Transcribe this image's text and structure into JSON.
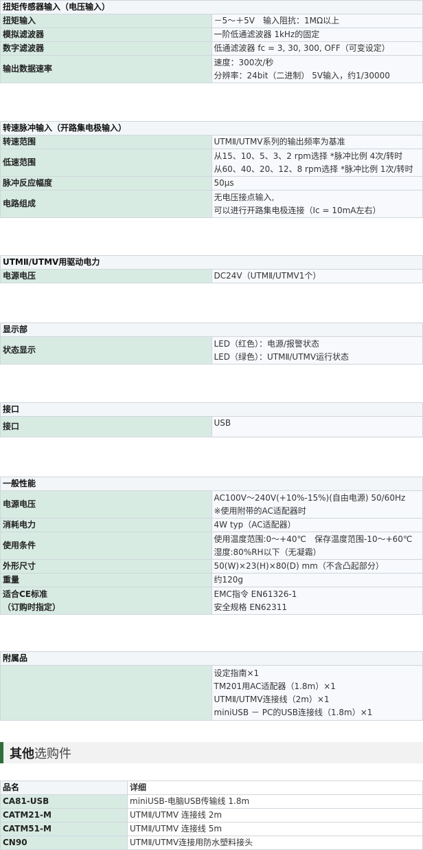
{
  "sections": [
    {
      "title": "扭矩传感器输入（电压输入）",
      "rows": [
        {
          "label": "扭矩输入",
          "lines": [
            "－5～＋5V　输入阻抗：1MΩ以上"
          ]
        },
        {
          "label": "模拟滤波器",
          "lines": [
            "一阶低通滤波器 1kHz的固定"
          ]
        },
        {
          "label": "数字滤波器",
          "lines": [
            "低通滤波器 fc = 3, 30, 300, OFF（可变设定）"
          ]
        },
        {
          "label": "输出数据速率",
          "lines": [
            "速度：300次/秒",
            "分辨率：24bit（二进制） 5V输入，约1/30000"
          ]
        }
      ]
    },
    {
      "title": "转速脉冲输入（开路集电极输入）",
      "rows": [
        {
          "label": "转速范围",
          "lines": [
            "UTMⅡ/UTMV系列的输出频率为基准"
          ]
        },
        {
          "label": "低速范围",
          "lines": [
            "从15、10、5、3、2 rpm选择 *脉冲比例 4次/转时",
            "从60、40、20、12、8 rpm选择 *脉冲比例 1次/转时"
          ]
        },
        {
          "label": "脉冲反应幅度",
          "lines": [
            "50μs"
          ]
        },
        {
          "label": "电路组成",
          "lines": [
            "无电压接点输入,",
            "可以进行开路集电极连接（Ic = 10mA左右）"
          ]
        }
      ]
    },
    {
      "title": "UTMⅡ/UTMV用驱动电力",
      "rows": [
        {
          "label": "电源电压",
          "lines": [
            "DC24V（UTMⅡ/UTMV1个）"
          ]
        }
      ]
    },
    {
      "title": "显示部",
      "rows": [
        {
          "label": "状态显示",
          "lines": [
            "LED（红色）：电源/报警状态",
            "LED（绿色）：UTMⅡ/UTMV运行状态"
          ]
        }
      ]
    },
    {
      "title": "接口",
      "rows": [
        {
          "label": "接口",
          "lines": [
            "USB"
          ]
        }
      ]
    },
    {
      "title": "一般性能",
      "rows": [
        {
          "label": "电源电压",
          "lines": [
            "AC100V～240V(+10%-15%)(自由电源) 50/60Hz",
            "※使用附带的AC适配器时"
          ]
        },
        {
          "label": "消耗电力",
          "lines": [
            "4W typ（AC适配器）"
          ]
        },
        {
          "label": "使用条件",
          "lines": [
            "使用温度范围:0～+40℃　保存温度范围-10～+60℃",
            "湿度:80%RH以下（无凝霜）"
          ]
        },
        {
          "label": "外形尺寸",
          "lines": [
            "50(W)×23(H)×80(D) mm（不含凸起部分）"
          ]
        },
        {
          "label": "重量",
          "lines": [
            "约120g"
          ]
        },
        {
          "label": "适合CE标准\n（订购时指定）",
          "lines": [
            "EMC指令 EN61326-1",
            "安全规格 EN62311"
          ]
        }
      ]
    },
    {
      "title": "附属品",
      "rows": [
        {
          "label": "",
          "lines": [
            "设定指南×1",
            "TM201用AC适配器（1.8m）×1",
            "UTMⅡ/UTMV连接线（2m）×1",
            "miniUSB － PC的USB连接线（1.8m）×1"
          ]
        }
      ]
    }
  ],
  "options": {
    "heading_bold": "其他",
    "heading_light": "选购件",
    "headers": [
      "品名",
      "详细"
    ],
    "rows": [
      {
        "name": "CA81-USB",
        "detail": "miniUSB-电脑USB传输线 1.8m"
      },
      {
        "name": "CATM21-M",
        "detail": "UTMⅡ/UTMV 连接线 2m"
      },
      {
        "name": "CATM51-M",
        "detail": "UTMⅡ/UTMV 连接线 5m"
      },
      {
        "name": "CN90",
        "detail": "UTMⅡ/UTMV连接用防水塑料接头"
      }
    ]
  }
}
